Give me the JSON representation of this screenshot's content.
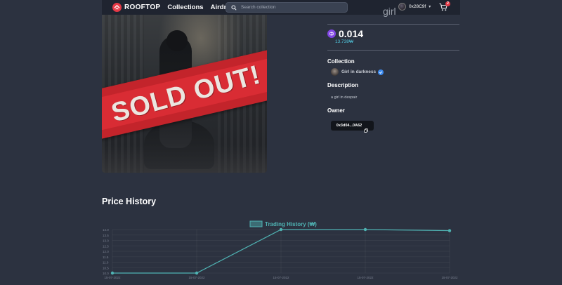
{
  "navbar": {
    "brand": "ROOFTOP",
    "links": [
      "Collections",
      "Airdrop"
    ],
    "search_placeholder": "Search collection",
    "account_name": "0x28C9f",
    "cart_count": "2"
  },
  "nft": {
    "title": "girl",
    "sold_label": "SOLD OUT!",
    "price": "0.014",
    "price_fiat": "13.738₩",
    "collection_label": "Collection",
    "collection_name": "Girl in darkness",
    "description_label": "Description",
    "description": "a girl in despair",
    "owner_label": "Owner",
    "owner_address": "0x3d04...0A62"
  },
  "colors": {
    "accent": "#4fc3d9",
    "badge": "#e63946",
    "matic": "#8247e5",
    "sold_banner": "#d92c34",
    "chart_line": "#4fb3b3"
  },
  "price_history": {
    "title": "Price History"
  },
  "chart_data": {
    "type": "line",
    "legend": "Trading History (₩)",
    "legend_position": "top-center",
    "x": [
      "15-07-2022",
      "15-07-2022",
      "15-07-2022",
      "15-07-2022",
      "15-07-2022"
    ],
    "series": [
      {
        "name": "Trading History (₩)",
        "values": [
          10.0,
          10.0,
          14.0,
          14.0,
          13.9
        ]
      }
    ],
    "y_ticks": [
      "14.0",
      "13.5",
      "13.0",
      "12.5",
      "12.0",
      "11.5",
      "11.0",
      "10.5",
      "10.0"
    ],
    "ylim": [
      10.0,
      14.0
    ],
    "grid": true
  }
}
